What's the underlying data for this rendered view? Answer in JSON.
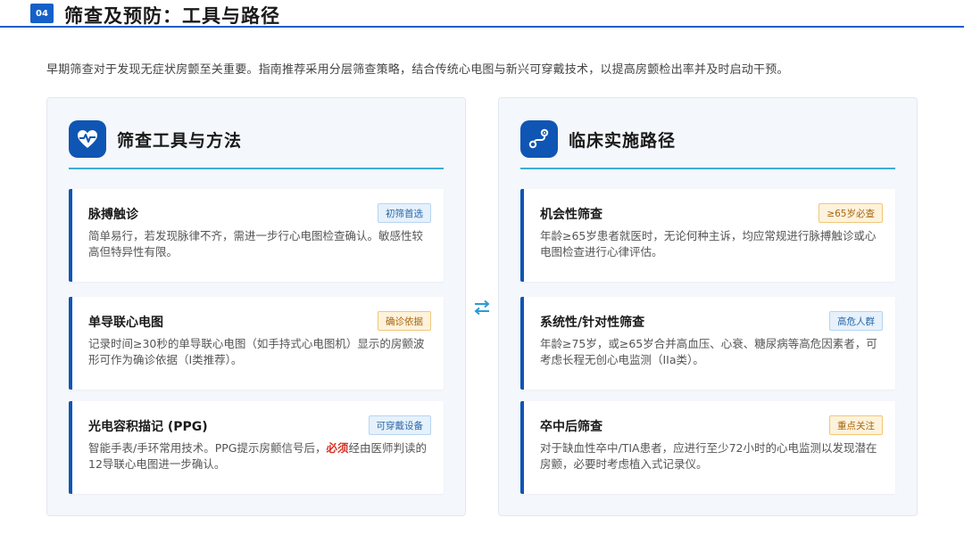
{
  "header": {
    "number": "04",
    "title": "筛查及预防：工具与路径"
  },
  "intro": "早期筛查对于发现无症状房颤至关重要。指南推荐采用分层筛查策略，结合传统心电图与新兴可穿戴技术，以提高房颤检出率并及时启动干预。",
  "left_panel": {
    "icon": "heart-pulse-icon",
    "title": "筛查工具与方法",
    "cards": [
      {
        "title": "脉搏触诊",
        "badge": "初筛首选",
        "badge_color": "blue",
        "desc": "简单易行，若发现脉律不齐，需进一步行心电图检查确认。敏感性较高但特异性有限。"
      },
      {
        "title": "单导联心电图",
        "badge": "确诊依据",
        "badge_color": "orange",
        "desc": "记录时间≥30秒的单导联心电图（如手持式心电图机）显示的房颤波形可作为确诊依据（I类推荐）。"
      },
      {
        "title": "光电容积描记 (PPG)",
        "badge": "可穿戴设备",
        "badge_color": "blue",
        "desc_pre": " 智能手表/手环常用技术。PPG提示房颤信号后，",
        "desc_em": "必须",
        "desc_post": "经由医师判读的12导联心电图进一步确认。"
      }
    ]
  },
  "right_panel": {
    "icon": "route-icon",
    "title": "临床实施路径",
    "cards": [
      {
        "title": "机会性筛查",
        "badge": "≥65岁必查",
        "badge_color": "orange",
        "desc": "年龄≥65岁患者就医时，无论何种主诉，均应常规进行脉搏触诊或心电图检查进行心律评估。"
      },
      {
        "title": "系统性/针对性筛查",
        "badge": "高危人群",
        "badge_color": "blue",
        "desc": "年龄≥75岁，或≥65岁合并高血压、心衰、糖尿病等高危因素者，可考虑长程无创心电监测（IIa类）。"
      },
      {
        "title": "卒中后筛查",
        "badge": "重点关注",
        "badge_color": "orange",
        "desc": "对于缺血性卒中/TIA患者，应进行至少72小时的心电监测以发现潜在房颤，必要时考虑植入式记录仪。"
      }
    ]
  },
  "colors": {
    "primary": "#0f55b4",
    "accent": "#3aaed8",
    "emphasis": "#d93025",
    "badge_orange": "#a8650d",
    "badge_blue": "#2a66a8"
  },
  "connector_icon": "swap-arrows-icon"
}
